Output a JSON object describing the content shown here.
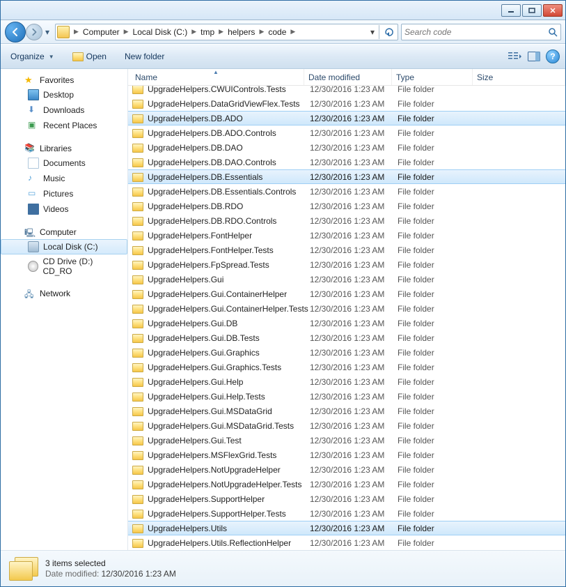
{
  "titlebar": {
    "min": "",
    "max": "",
    "close": ""
  },
  "breadcrumb": {
    "parts": [
      "Computer",
      "Local Disk (C:)",
      "tmp",
      "helpers",
      "code"
    ]
  },
  "search": {
    "placeholder": "Search code"
  },
  "toolbar": {
    "organize": "Organize",
    "open": "Open",
    "newfolder": "New folder"
  },
  "nav": {
    "favorites": "Favorites",
    "desktop": "Desktop",
    "downloads": "Downloads",
    "recent": "Recent Places",
    "libraries": "Libraries",
    "documents": "Documents",
    "music": "Music",
    "pictures": "Pictures",
    "videos": "Videos",
    "computer": "Computer",
    "localdisk": "Local Disk (C:)",
    "cddrive": "CD Drive (D:) CD_RO",
    "network": "Network"
  },
  "columns": {
    "name": "Name",
    "date": "Date modified",
    "type": "Type",
    "size": "Size"
  },
  "rows": [
    {
      "name": "UpgradeHelpers.CWUIControls.Tests",
      "date": "12/30/2016 1:23 AM",
      "type": "File folder",
      "sel": false
    },
    {
      "name": "UpgradeHelpers.DataGridViewFlex.Tests",
      "date": "12/30/2016 1:23 AM",
      "type": "File folder",
      "sel": false
    },
    {
      "name": "UpgradeHelpers.DB.ADO",
      "date": "12/30/2016 1:23 AM",
      "type": "File folder",
      "sel": true
    },
    {
      "name": "UpgradeHelpers.DB.ADO.Controls",
      "date": "12/30/2016 1:23 AM",
      "type": "File folder",
      "sel": false
    },
    {
      "name": "UpgradeHelpers.DB.DAO",
      "date": "12/30/2016 1:23 AM",
      "type": "File folder",
      "sel": false
    },
    {
      "name": "UpgradeHelpers.DB.DAO.Controls",
      "date": "12/30/2016 1:23 AM",
      "type": "File folder",
      "sel": false
    },
    {
      "name": "UpgradeHelpers.DB.Essentials",
      "date": "12/30/2016 1:23 AM",
      "type": "File folder",
      "sel": true
    },
    {
      "name": "UpgradeHelpers.DB.Essentials.Controls",
      "date": "12/30/2016 1:23 AM",
      "type": "File folder",
      "sel": false
    },
    {
      "name": "UpgradeHelpers.DB.RDO",
      "date": "12/30/2016 1:23 AM",
      "type": "File folder",
      "sel": false
    },
    {
      "name": "UpgradeHelpers.DB.RDO.Controls",
      "date": "12/30/2016 1:23 AM",
      "type": "File folder",
      "sel": false
    },
    {
      "name": "UpgradeHelpers.FontHelper",
      "date": "12/30/2016 1:23 AM",
      "type": "File folder",
      "sel": false
    },
    {
      "name": "UpgradeHelpers.FontHelper.Tests",
      "date": "12/30/2016 1:23 AM",
      "type": "File folder",
      "sel": false
    },
    {
      "name": "UpgradeHelpers.FpSpread.Tests",
      "date": "12/30/2016 1:23 AM",
      "type": "File folder",
      "sel": false
    },
    {
      "name": "UpgradeHelpers.Gui",
      "date": "12/30/2016 1:23 AM",
      "type": "File folder",
      "sel": false
    },
    {
      "name": "UpgradeHelpers.Gui.ContainerHelper",
      "date": "12/30/2016 1:23 AM",
      "type": "File folder",
      "sel": false
    },
    {
      "name": "UpgradeHelpers.Gui.ContainerHelper.Tests",
      "date": "12/30/2016 1:23 AM",
      "type": "File folder",
      "sel": false
    },
    {
      "name": "UpgradeHelpers.Gui.DB",
      "date": "12/30/2016 1:23 AM",
      "type": "File folder",
      "sel": false
    },
    {
      "name": "UpgradeHelpers.Gui.DB.Tests",
      "date": "12/30/2016 1:23 AM",
      "type": "File folder",
      "sel": false
    },
    {
      "name": "UpgradeHelpers.Gui.Graphics",
      "date": "12/30/2016 1:23 AM",
      "type": "File folder",
      "sel": false
    },
    {
      "name": "UpgradeHelpers.Gui.Graphics.Tests",
      "date": "12/30/2016 1:23 AM",
      "type": "File folder",
      "sel": false
    },
    {
      "name": "UpgradeHelpers.Gui.Help",
      "date": "12/30/2016 1:23 AM",
      "type": "File folder",
      "sel": false
    },
    {
      "name": "UpgradeHelpers.Gui.Help.Tests",
      "date": "12/30/2016 1:23 AM",
      "type": "File folder",
      "sel": false
    },
    {
      "name": "UpgradeHelpers.Gui.MSDataGrid",
      "date": "12/30/2016 1:23 AM",
      "type": "File folder",
      "sel": false
    },
    {
      "name": "UpgradeHelpers.Gui.MSDataGrid.Tests",
      "date": "12/30/2016 1:23 AM",
      "type": "File folder",
      "sel": false
    },
    {
      "name": "UpgradeHelpers.Gui.Test",
      "date": "12/30/2016 1:23 AM",
      "type": "File folder",
      "sel": false
    },
    {
      "name": "UpgradeHelpers.MSFlexGrid.Tests",
      "date": "12/30/2016 1:23 AM",
      "type": "File folder",
      "sel": false
    },
    {
      "name": "UpgradeHelpers.NotUpgradeHelper",
      "date": "12/30/2016 1:23 AM",
      "type": "File folder",
      "sel": false
    },
    {
      "name": "UpgradeHelpers.NotUpgradeHelper.Tests",
      "date": "12/30/2016 1:23 AM",
      "type": "File folder",
      "sel": false
    },
    {
      "name": "UpgradeHelpers.SupportHelper",
      "date": "12/30/2016 1:23 AM",
      "type": "File folder",
      "sel": false
    },
    {
      "name": "UpgradeHelpers.SupportHelper.Tests",
      "date": "12/30/2016 1:23 AM",
      "type": "File folder",
      "sel": false
    },
    {
      "name": "UpgradeHelpers.Utils",
      "date": "12/30/2016 1:23 AM",
      "type": "File folder",
      "sel": true
    },
    {
      "name": "UpgradeHelpers.Utils.ReflectionHelper",
      "date": "12/30/2016 1:23 AM",
      "type": "File folder",
      "sel": false
    }
  ],
  "details": {
    "title": "3 items selected",
    "label": "Date modified:",
    "value": "12/30/2016 1:23 AM"
  }
}
